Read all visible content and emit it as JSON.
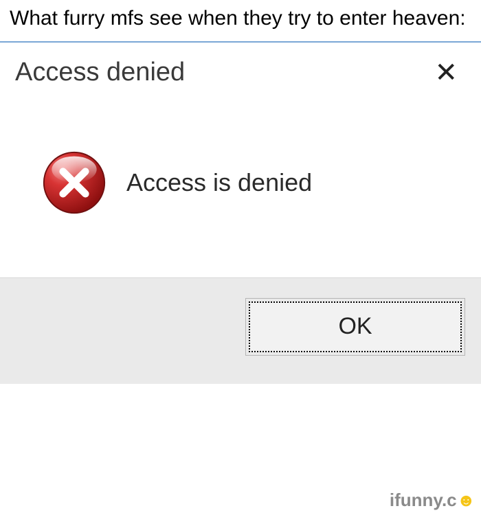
{
  "caption": "What furry mfs see when they try to enter heaven:",
  "dialog": {
    "title": "Access denied",
    "close_label": "✕",
    "message": "Access is denied",
    "ok_label": "OK"
  },
  "watermark": {
    "part1": "ifunny.c",
    "part2": "☻"
  },
  "icon": "error-icon"
}
